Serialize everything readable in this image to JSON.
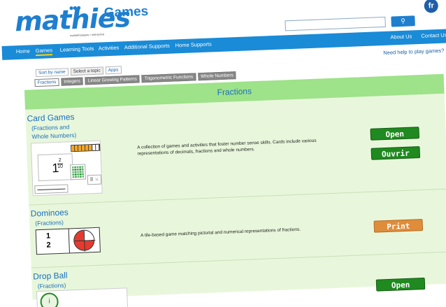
{
  "header": {
    "logo_text": "mathies",
    "logo_tagline": "mathématiques • interactive",
    "games_label": "Games",
    "lang_toggle": "fr",
    "search": {
      "value": "",
      "placeholder": "",
      "button_icon": "search-icon"
    }
  },
  "nav": {
    "left": [
      "Home",
      "Games",
      "Learning Tools",
      "Activities",
      "Additional Supports",
      "Home Supports"
    ],
    "active": "Games",
    "right": [
      "About Us",
      "Contact Us"
    ]
  },
  "help_link": "Need help to play games?",
  "sort_tabs": [
    "Sort by name",
    "Select a topic",
    "Apps"
  ],
  "sort_selected": "Select a topic",
  "topic_tabs": [
    "Fractions",
    "Integers",
    "Linear Growing Patterns",
    "Trigonometric Functions",
    "Whole Numbers"
  ],
  "topic_selected": "Fractions",
  "section_title": "Fractions",
  "games": [
    {
      "title": "Card Games",
      "subtitle_lines": [
        "(Fractions and",
        "Whole Numbers)"
      ],
      "description": "A collection of games and activities that foster number sense skills. Cards include various representations of decimals, fractions and whole numbers.",
      "buttons": [
        "Open",
        "Ouvrir"
      ],
      "thumbnail": {
        "whole": "1",
        "numerator": "2",
        "denominator": "10",
        "dice": "⠿ ⁙"
      }
    },
    {
      "title": "Dominoes",
      "subtitle_lines": [
        "(Fractions)"
      ],
      "description": "A tile-based game matching pictorial and numerical representations of fractions.",
      "buttons": [
        "Print"
      ],
      "thumbnail": {
        "numerator": "1",
        "denominator": "2"
      }
    },
    {
      "title": "Drop Ball",
      "subtitle_lines": [
        "(Fractions)"
      ],
      "description": "",
      "buttons": [
        "Open"
      ],
      "thumbnail": {
        "glyph": "i"
      }
    }
  ],
  "colors": {
    "brand_blue": "#1e7fcf",
    "nav_blue": "#1a8bd6",
    "section_green": "#9ee28a",
    "content_bg": "#e8f7db",
    "button_green": "#1f8a1f",
    "button_orange": "#df8d3b"
  }
}
